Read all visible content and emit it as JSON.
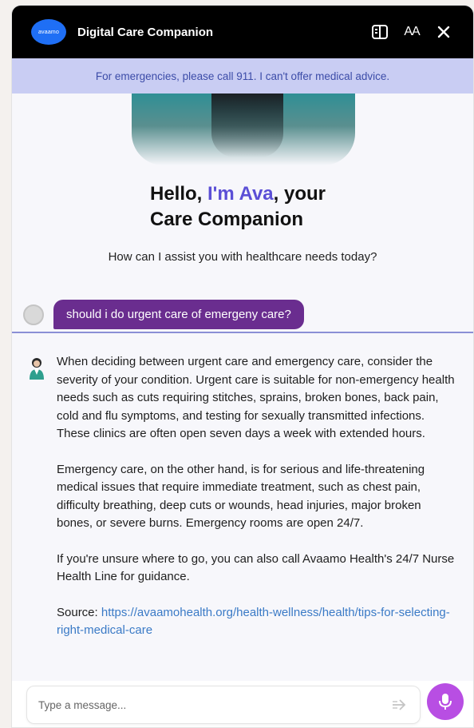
{
  "header": {
    "logo_text": "avaamo",
    "title": "Digital Care Companion",
    "icons": [
      "sidebar-toggle-icon",
      "font-size-icon",
      "close-icon"
    ],
    "font_icon_text": "AA"
  },
  "banner": {
    "text": "For emergencies, please call 911. I can't offer medical advice."
  },
  "welcome": {
    "line_prefix": "Hello, ",
    "name": "I'm Ava",
    "line_suffix": ", your",
    "line2": "Care Companion",
    "subtitle": "How can I assist you with healthcare needs today?"
  },
  "conversation": {
    "user_message": "should i do urgent care of emergeny care?",
    "bot_paragraphs": [
      "When deciding between urgent care and emergency care, consider the severity of your condition. Urgent care is suitable for non-emergency health needs such as cuts requiring stitches, sprains, broken bones, back pain, cold and flu symptoms, and testing for sexually transmitted infections. These clinics are often open seven days a week with extended hours.",
      "Emergency care, on the other hand, is for serious and life-threatening medical issues that require immediate treatment, such as chest pain, difficulty breathing, deep cuts or wounds, head injuries, major broken bones, or severe burns. Emergency rooms are open 24/7.",
      "If you're unsure where to go, you can also call Avaamo Health's 24/7 Nurse Health Line for guidance."
    ],
    "source_label": "Source: ",
    "source_url": "https://avaamohealth.org/health-wellness/health/tips-for-selecting-right-medical-care"
  },
  "composer": {
    "placeholder": "Type a message..."
  },
  "colors": {
    "header_bg": "#000000",
    "banner_bg": "#c9cdf3",
    "banner_text": "#3c4ca8",
    "accent": "#5b4fd6",
    "user_bubble": "#6a2d8f",
    "mic_button": "#b84ee3",
    "link": "#3a7ac6"
  }
}
